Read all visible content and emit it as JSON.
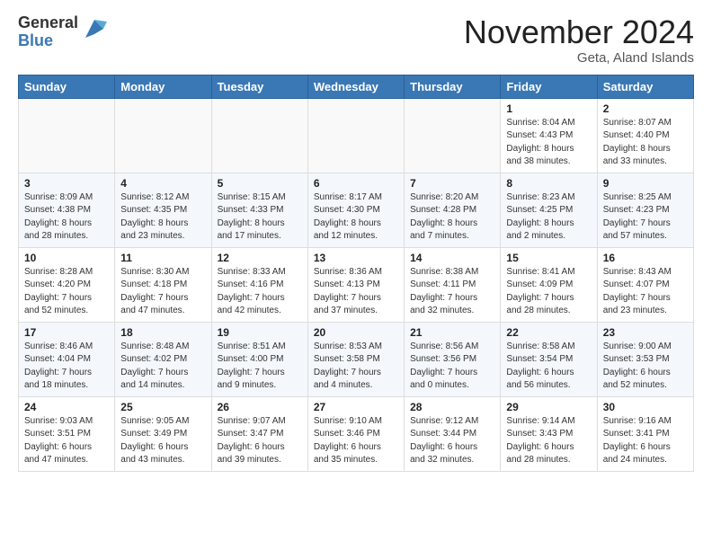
{
  "logo": {
    "general": "General",
    "blue": "Blue"
  },
  "header": {
    "month": "November 2024",
    "location": "Geta, Aland Islands"
  },
  "weekdays": [
    "Sunday",
    "Monday",
    "Tuesday",
    "Wednesday",
    "Thursday",
    "Friday",
    "Saturday"
  ],
  "weeks": [
    [
      {
        "day": "",
        "empty": true
      },
      {
        "day": "",
        "empty": true
      },
      {
        "day": "",
        "empty": true
      },
      {
        "day": "",
        "empty": true
      },
      {
        "day": "",
        "empty": true
      },
      {
        "day": "1",
        "sunrise": "8:04 AM",
        "sunset": "4:43 PM",
        "daylight": "8 hours and 38 minutes."
      },
      {
        "day": "2",
        "sunrise": "8:07 AM",
        "sunset": "4:40 PM",
        "daylight": "8 hours and 33 minutes."
      }
    ],
    [
      {
        "day": "3",
        "sunrise": "8:09 AM",
        "sunset": "4:38 PM",
        "daylight": "8 hours and 28 minutes."
      },
      {
        "day": "4",
        "sunrise": "8:12 AM",
        "sunset": "4:35 PM",
        "daylight": "8 hours and 23 minutes."
      },
      {
        "day": "5",
        "sunrise": "8:15 AM",
        "sunset": "4:33 PM",
        "daylight": "8 hours and 17 minutes."
      },
      {
        "day": "6",
        "sunrise": "8:17 AM",
        "sunset": "4:30 PM",
        "daylight": "8 hours and 12 minutes."
      },
      {
        "day": "7",
        "sunrise": "8:20 AM",
        "sunset": "4:28 PM",
        "daylight": "8 hours and 7 minutes."
      },
      {
        "day": "8",
        "sunrise": "8:23 AM",
        "sunset": "4:25 PM",
        "daylight": "8 hours and 2 minutes."
      },
      {
        "day": "9",
        "sunrise": "8:25 AM",
        "sunset": "4:23 PM",
        "daylight": "7 hours and 57 minutes."
      }
    ],
    [
      {
        "day": "10",
        "sunrise": "8:28 AM",
        "sunset": "4:20 PM",
        "daylight": "7 hours and 52 minutes."
      },
      {
        "day": "11",
        "sunrise": "8:30 AM",
        "sunset": "4:18 PM",
        "daylight": "7 hours and 47 minutes."
      },
      {
        "day": "12",
        "sunrise": "8:33 AM",
        "sunset": "4:16 PM",
        "daylight": "7 hours and 42 minutes."
      },
      {
        "day": "13",
        "sunrise": "8:36 AM",
        "sunset": "4:13 PM",
        "daylight": "7 hours and 37 minutes."
      },
      {
        "day": "14",
        "sunrise": "8:38 AM",
        "sunset": "4:11 PM",
        "daylight": "7 hours and 32 minutes."
      },
      {
        "day": "15",
        "sunrise": "8:41 AM",
        "sunset": "4:09 PM",
        "daylight": "7 hours and 28 minutes."
      },
      {
        "day": "16",
        "sunrise": "8:43 AM",
        "sunset": "4:07 PM",
        "daylight": "7 hours and 23 minutes."
      }
    ],
    [
      {
        "day": "17",
        "sunrise": "8:46 AM",
        "sunset": "4:04 PM",
        "daylight": "7 hours and 18 minutes."
      },
      {
        "day": "18",
        "sunrise": "8:48 AM",
        "sunset": "4:02 PM",
        "daylight": "7 hours and 14 minutes."
      },
      {
        "day": "19",
        "sunrise": "8:51 AM",
        "sunset": "4:00 PM",
        "daylight": "7 hours and 9 minutes."
      },
      {
        "day": "20",
        "sunrise": "8:53 AM",
        "sunset": "3:58 PM",
        "daylight": "7 hours and 4 minutes."
      },
      {
        "day": "21",
        "sunrise": "8:56 AM",
        "sunset": "3:56 PM",
        "daylight": "7 hours and 0 minutes."
      },
      {
        "day": "22",
        "sunrise": "8:58 AM",
        "sunset": "3:54 PM",
        "daylight": "6 hours and 56 minutes."
      },
      {
        "day": "23",
        "sunrise": "9:00 AM",
        "sunset": "3:53 PM",
        "daylight": "6 hours and 52 minutes."
      }
    ],
    [
      {
        "day": "24",
        "sunrise": "9:03 AM",
        "sunset": "3:51 PM",
        "daylight": "6 hours and 47 minutes."
      },
      {
        "day": "25",
        "sunrise": "9:05 AM",
        "sunset": "3:49 PM",
        "daylight": "6 hours and 43 minutes."
      },
      {
        "day": "26",
        "sunrise": "9:07 AM",
        "sunset": "3:47 PM",
        "daylight": "6 hours and 39 minutes."
      },
      {
        "day": "27",
        "sunrise": "9:10 AM",
        "sunset": "3:46 PM",
        "daylight": "6 hours and 35 minutes."
      },
      {
        "day": "28",
        "sunrise": "9:12 AM",
        "sunset": "3:44 PM",
        "daylight": "6 hours and 32 minutes."
      },
      {
        "day": "29",
        "sunrise": "9:14 AM",
        "sunset": "3:43 PM",
        "daylight": "6 hours and 28 minutes."
      },
      {
        "day": "30",
        "sunrise": "9:16 AM",
        "sunset": "3:41 PM",
        "daylight": "6 hours and 24 minutes."
      }
    ]
  ],
  "labels": {
    "sunrise": "Sunrise:",
    "sunset": "Sunset:",
    "daylight": "Daylight:"
  }
}
